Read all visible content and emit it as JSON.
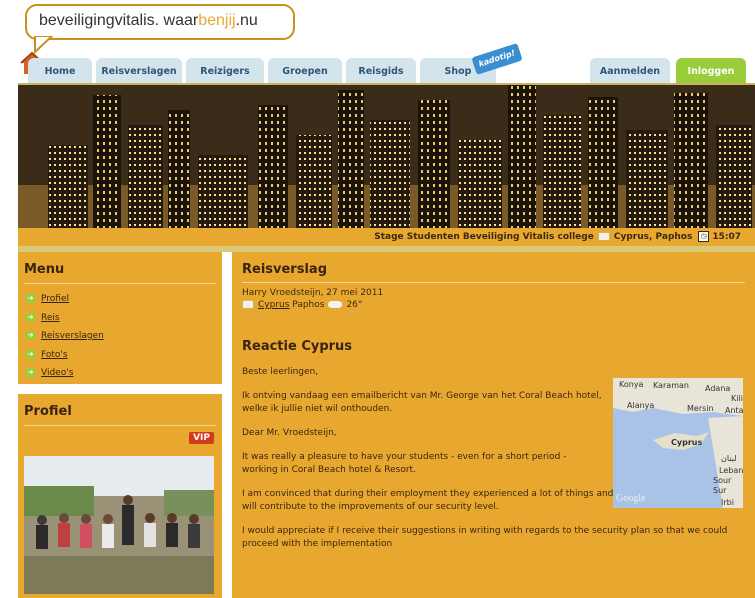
{
  "logo": {
    "text_main": "beveiligingvitalis.",
    "text_waar": "waar",
    "text_accent": "benjij",
    "text_tld": ".nu"
  },
  "nav": {
    "tabs": [
      {
        "label": "Home"
      },
      {
        "label": "Reisverslagen"
      },
      {
        "label": "Reizigers"
      },
      {
        "label": "Groepen"
      },
      {
        "label": "Reisgids"
      },
      {
        "label": "Shop"
      },
      {
        "label": "Aanmelden"
      },
      {
        "label": "Inloggen"
      }
    ],
    "kadotip": "kadotip!"
  },
  "status": {
    "group": "Stage Studenten Beveiliging Vitalis college",
    "location": "Cyprus, Paphos",
    "time": "15:07"
  },
  "menu": {
    "title": "Menu",
    "items": [
      {
        "label": "Profiel"
      },
      {
        "label": "Reis"
      },
      {
        "label": "Reisverslagen"
      },
      {
        "label": "Foto's"
      },
      {
        "label": "Video's"
      }
    ]
  },
  "profile": {
    "title": "Profiel",
    "badge": "VIP"
  },
  "report": {
    "title": "Reisverslag",
    "author_date": "Harry Vroedsteijn, 27 mei 2011",
    "country_link": "Cyprus",
    "city": "Paphos",
    "temperature": "26°",
    "heading": "Reactie Cyprus",
    "paragraphs": [
      "Beste leerlingen,",
      "Ik ontving vandaag een emailbericht van Mr. George van het Coral Beach hotel, welke ik jullie niet wil onthouden.",
      "Dear Mr. Vroedsteijn,",
      "It was really a pleasure to have your students - even for a short period - working in Coral Beach hotel & Resort.",
      "I am convinced that during their employment they experienced a lot of things and together with their findings will contribute to the improvements of our security level.",
      "I would appreciate if I receive their suggestions in writing with regards to the security plan so that we could proceed with the implementation"
    ]
  },
  "map": {
    "labels": [
      "Konya",
      "Karaman",
      "Adana",
      "Kili",
      "Alanya",
      "Mersin",
      "Antaky",
      "Cyprus",
      "لبنان",
      "Lebanon",
      "Sour",
      "Sur",
      "Irbi"
    ],
    "brand": "Google"
  },
  "colors": {
    "orange": "#e8a830",
    "tab_blue": "#d3e4ed",
    "login_green": "#9acd3a",
    "text_brown": "#3a2410"
  },
  "icons": [
    "house-logo-icon",
    "flag-icon",
    "clock-icon",
    "arrow-icon",
    "cloud-icon",
    "kadotip-badge"
  ]
}
